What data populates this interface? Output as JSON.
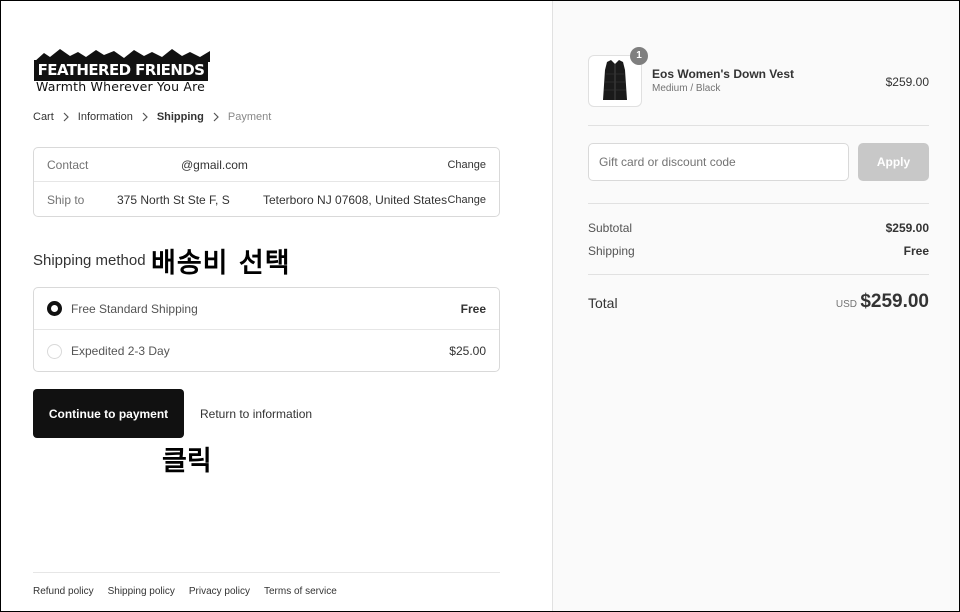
{
  "logo": {
    "title": "FEATHERED FRIENDS",
    "tagline": "Warmth Wherever You Are"
  },
  "breadcrumb": [
    "Cart",
    "Information",
    "Shipping",
    "Payment"
  ],
  "info": {
    "contact_label": "Contact",
    "contact_value": "@gmail.com",
    "shipto_label": "Ship to",
    "shipto_street": "375 North St Ste F, S",
    "shipto_city": "Teterboro NJ 07608, United States",
    "change_label": "Change"
  },
  "shipping_method": {
    "title": "Shipping method",
    "options": [
      {
        "name": "Free Standard Shipping",
        "price": "Free",
        "selected": true
      },
      {
        "name": "Expedited 2-3 Day",
        "price": "$25.00",
        "selected": false
      }
    ]
  },
  "annotations": {
    "select_shipping": "배송비 선택",
    "click": "클릭"
  },
  "actions": {
    "continue": "Continue to payment",
    "return": "Return to information"
  },
  "footer": [
    "Refund policy",
    "Shipping policy",
    "Privacy policy",
    "Terms of service"
  ],
  "cart": {
    "quantity": "1",
    "product_name": "Eos Women's Down Vest",
    "product_variant": "Medium / Black",
    "product_price": "$259.00",
    "discount_placeholder": "Gift card or discount code",
    "apply_label": "Apply",
    "subtotal_label": "Subtotal",
    "subtotal_value": "$259.00",
    "shipping_label": "Shipping",
    "shipping_value": "Free",
    "total_label": "Total",
    "currency": "USD",
    "total_value": "$259.00"
  }
}
